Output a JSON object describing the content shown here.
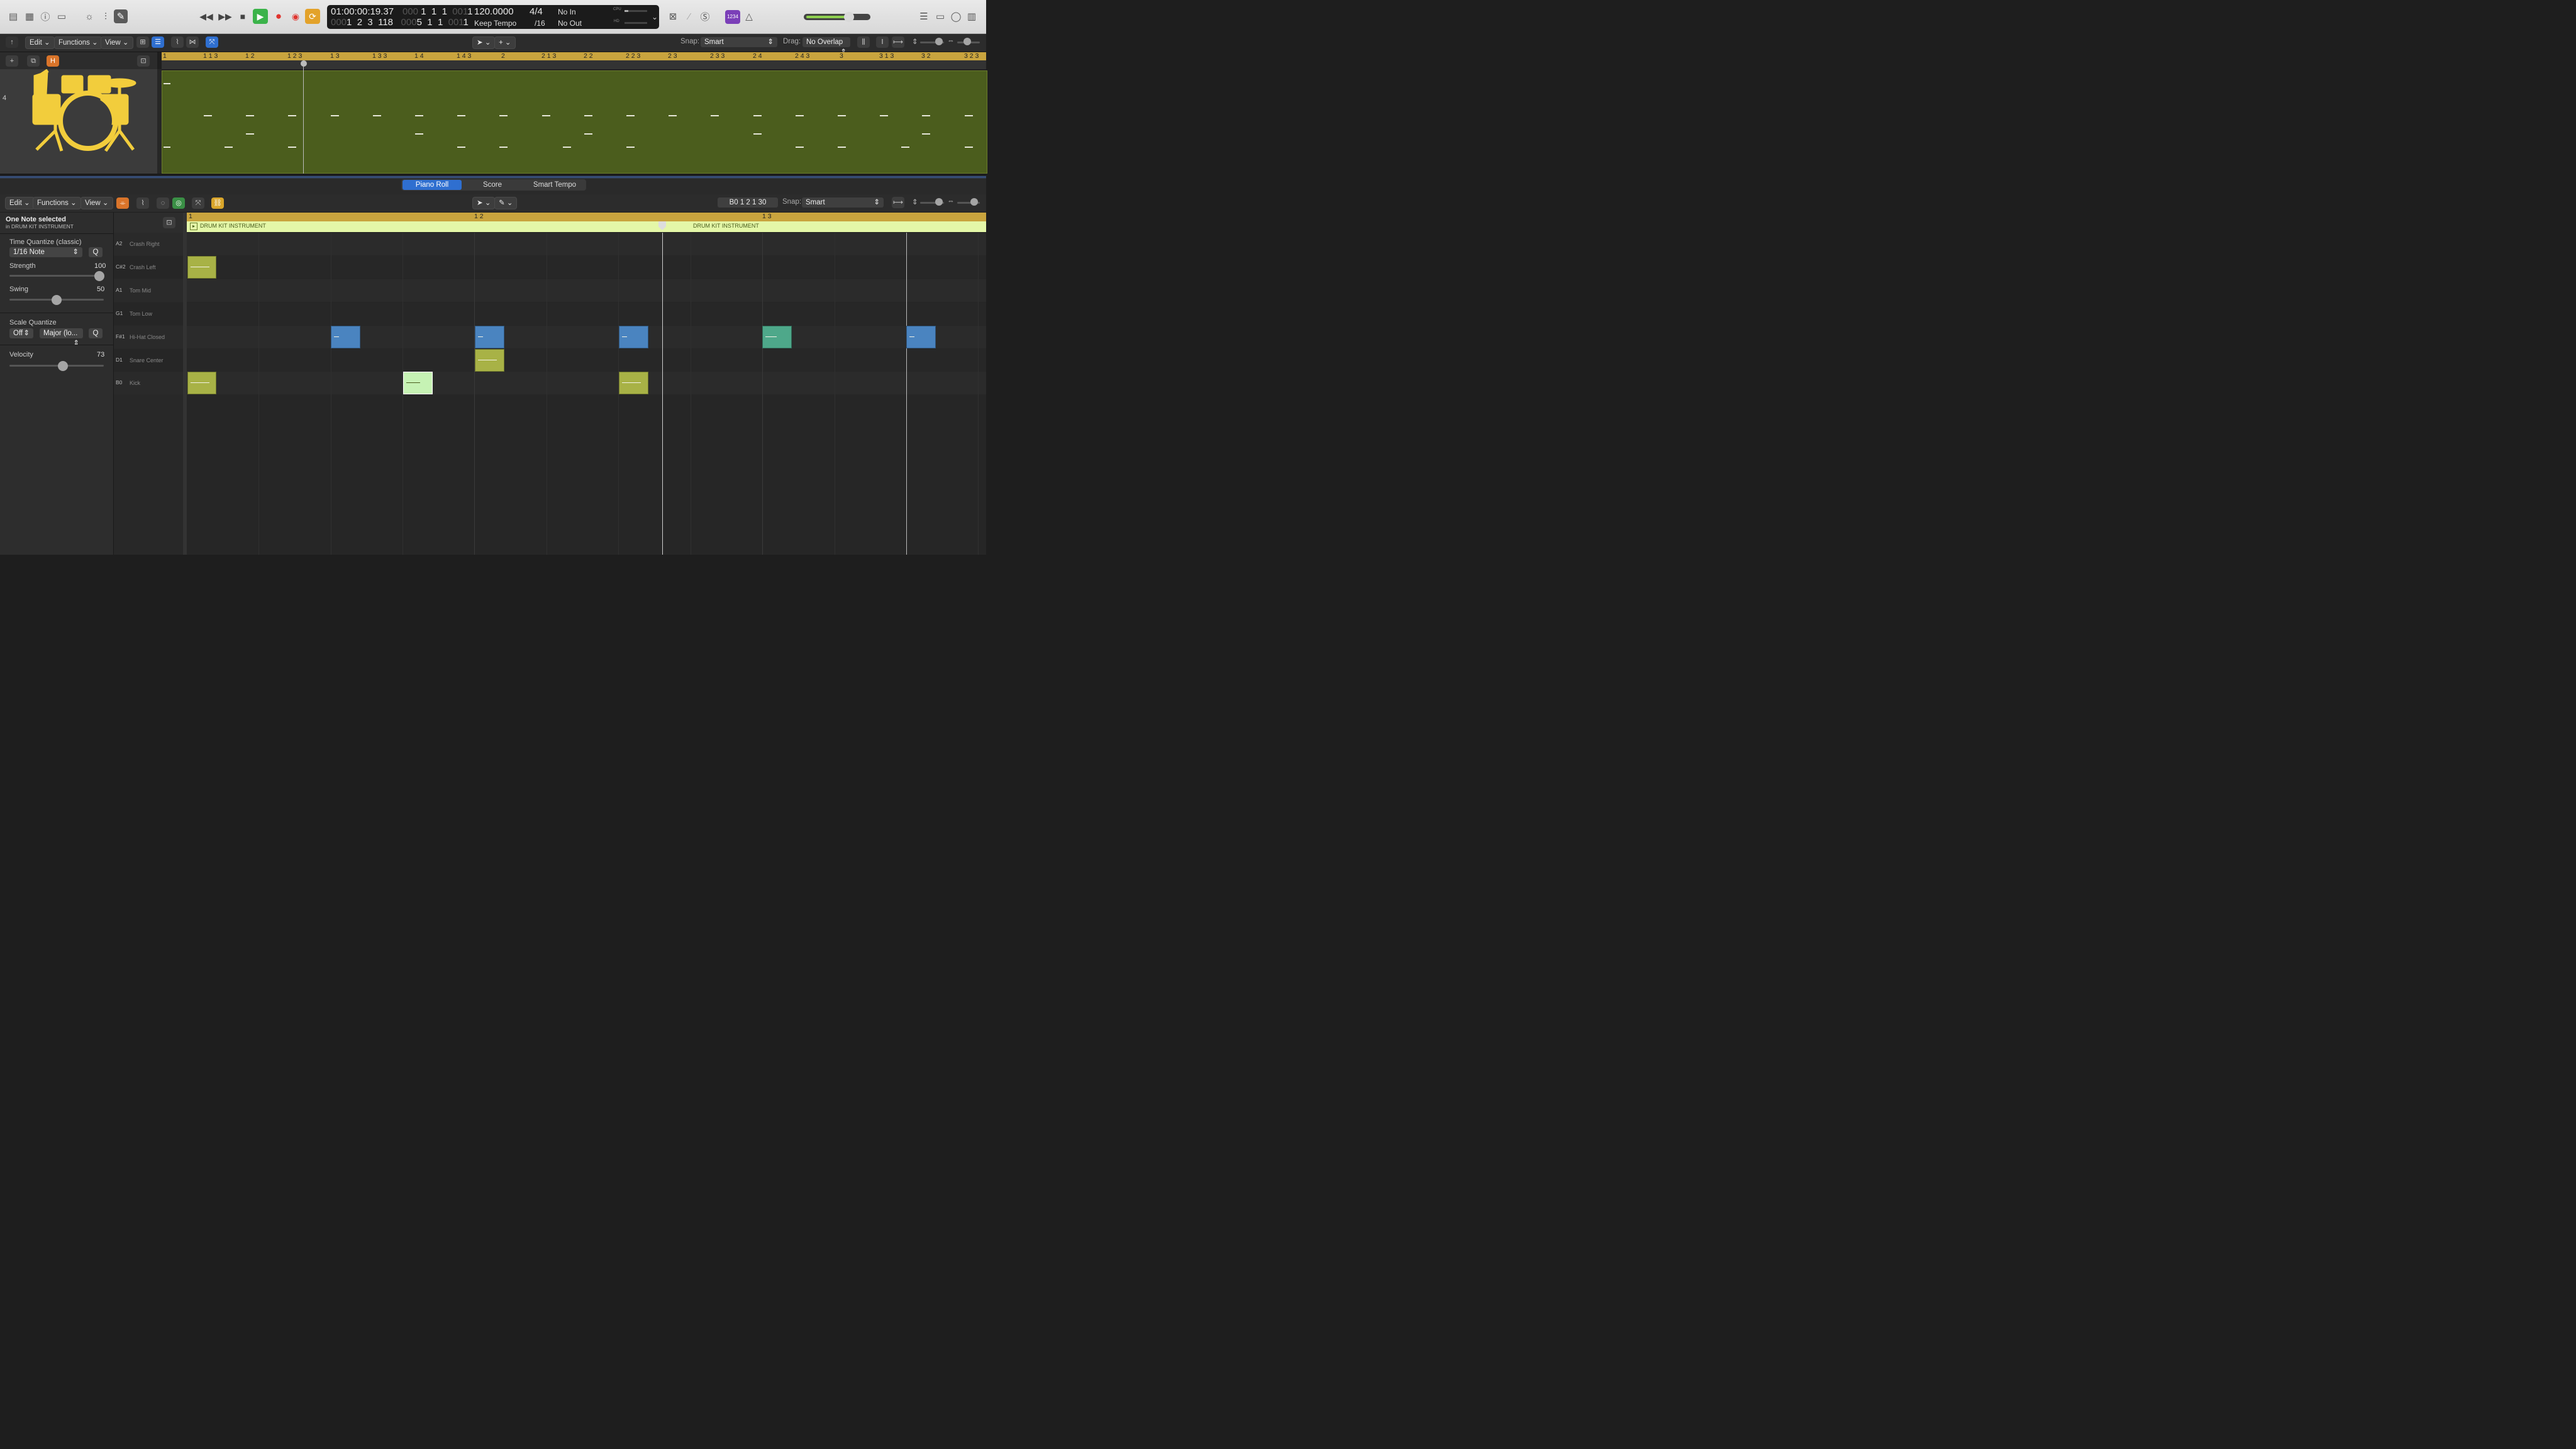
{
  "transport": {
    "time": "01:00:00:19.37",
    "bars_top": [
      "000",
      "1",
      "1",
      "1",
      "001",
      "1"
    ],
    "bars_bottom": [
      "000",
      "1",
      "2",
      "3",
      "118",
      "000",
      "5",
      "1",
      "1",
      "001",
      "1"
    ],
    "tempo": "120.0000",
    "tempo_mode": "Keep Tempo",
    "signature": "4/4",
    "division": "/16",
    "in": "No In",
    "out": "No Out",
    "cpu": "CPU",
    "hd": "HD",
    "count_in": "1234"
  },
  "tracks_toolbar": {
    "edit": "Edit",
    "functions": "Functions",
    "view": "View",
    "snap_label": "Snap:",
    "snap_value": "Smart",
    "drag_label": "Drag:",
    "drag_value": "No Overlap"
  },
  "track_header": {
    "number": "4",
    "h_button": "H"
  },
  "tracks_ruler": [
    "1",
    "1 1 3",
    "1 2",
    "1 2 3",
    "1 3",
    "1 3 3",
    "1 4",
    "1 4 3",
    "2",
    "2 1 3",
    "2 2",
    "2 2 3",
    "2 3",
    "2 3 3",
    "2 4",
    "2 4 3",
    "3",
    "3 1 3",
    "3 2",
    "3 2 3"
  ],
  "tabs": [
    "Piano Roll",
    "Score",
    "Smart Tempo"
  ],
  "piano_toolbar": {
    "edit": "Edit",
    "functions": "Functions",
    "view": "View",
    "position": "B0  1 2 1 30",
    "snap_label": "Snap:",
    "snap_value": "Smart"
  },
  "inspector": {
    "selection": "One Note selected",
    "selection_sub": "in DRUM KIT INSTRUMENT",
    "time_quantize_label": "Time Quantize (classic)",
    "time_quantize_value": "1/16 Note",
    "q": "Q",
    "strength_label": "Strength",
    "strength_value": "100",
    "swing_label": "Swing",
    "swing_value": "50",
    "scale_quantize_label": "Scale Quantize",
    "scale_off": "Off",
    "scale_mode": "Major (lo...",
    "velocity_label": "Velocity",
    "velocity_value": "73"
  },
  "piano_ruler": [
    "1",
    "1 2",
    "1 3"
  ],
  "region_names": [
    "DRUM KIT INSTRUMENT",
    "DRUM KIT INSTRUMENT"
  ],
  "keys": [
    {
      "note": "A2",
      "name": "Crash Right"
    },
    {
      "note": "C#2",
      "name": "Crash Left"
    },
    {
      "note": "A1",
      "name": "Tom Mid"
    },
    {
      "note": "G1",
      "name": "Tom Low"
    },
    {
      "note": "F#1",
      "name": "Hi-Hat Closed"
    },
    {
      "note": "D1",
      "name": "Snare Center"
    },
    {
      "note": "B0",
      "name": "Kick"
    }
  ],
  "colors": {
    "accent": "#2f6fd0",
    "ruler": "#c9a43e",
    "region": "#4b5d1d",
    "drum_icon": "#f2cd3c",
    "note_olive": "#a8b246",
    "note_blue": "#4a84c0",
    "note_teal": "#4ea88a",
    "note_selected": "#c6f2b4",
    "play_green": "#3bb34a",
    "record_red": "#e0342e",
    "cycle_orange": "#e3a22a"
  },
  "icons": [
    "library-icon",
    "inspector-icon",
    "help-icon",
    "toolbar-icon",
    "brightness-icon",
    "mixer-icon",
    "pencil-icon",
    "rewind-icon",
    "fast-forward-icon",
    "stop-icon",
    "play-icon",
    "record-icon",
    "capture-icon",
    "cycle-icon",
    "metronome-icon",
    "list-icon",
    "notepad-icon",
    "loop-browser-icon",
    "media-icon"
  ]
}
